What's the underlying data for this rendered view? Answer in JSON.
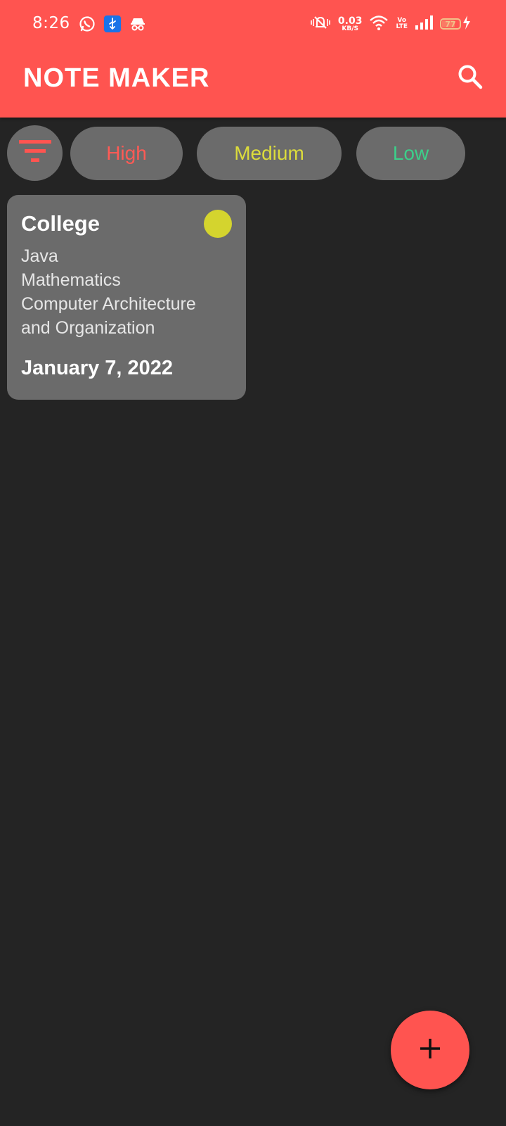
{
  "status_bar": {
    "time": "8:26",
    "net_speed_value": "0.03",
    "net_speed_unit": "KB/S",
    "volte_top": "Vo",
    "volte_bottom": "LTE",
    "battery_level": "77",
    "battery_fraction": 0.77,
    "left_icons": [
      "whatsapp-icon",
      "usb-icon",
      "incognito-icon"
    ],
    "right_icons": [
      "mute-icon",
      "wifi-icon",
      "signal-icon",
      "charging-icon"
    ]
  },
  "app_bar": {
    "title": "NOTE MAKER",
    "search_icon": "search-icon"
  },
  "filters": {
    "filter_icon": "filter-icon",
    "chips": [
      {
        "label": "High",
        "color": "#ff5a55"
      },
      {
        "label": "Medium",
        "color": "#dcdc3c"
      },
      {
        "label": "Low",
        "color": "#3cd08a"
      }
    ]
  },
  "notes": [
    {
      "title": "College",
      "lines": [
        "Java",
        "Mathematics",
        "Computer Architecture",
        "and Organization"
      ],
      "date": "January 7, 2022",
      "priority_color": "#d4d42e"
    }
  ],
  "fab": {
    "icon": "plus-icon",
    "color": "#ff5450"
  },
  "colors": {
    "accent": "#ff5450",
    "background": "#242424",
    "surface": "#6b6b6b"
  }
}
